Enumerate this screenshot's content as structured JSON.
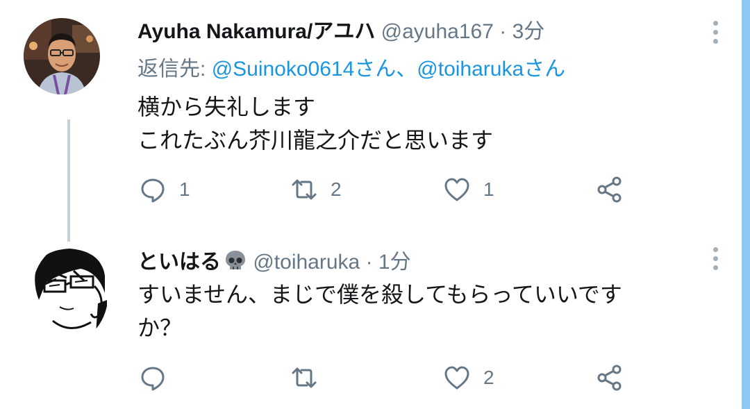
{
  "tweets": [
    {
      "display_name": "Ayuha Nakamura/アユハ",
      "handle": "@ayuha167",
      "separator": "·",
      "time": "3分",
      "reply_prefix": "返信先:",
      "reply_mentions": "@Suinoko0614さん、@toiharukaさん",
      "lines": [
        "横から失礼します",
        "これたぶん芥川龍之介だと思います"
      ],
      "counts": {
        "reply": "1",
        "retweet": "2",
        "like": "1"
      }
    },
    {
      "display_name": "といはる",
      "name_emoji": "skull-icon",
      "handle": "@toiharuka",
      "separator": "·",
      "time": "1分",
      "lines": [
        "すいません、まじで僕を殺してもらっていいです",
        "か？"
      ],
      "counts": {
        "reply": "",
        "retweet": "",
        "like": "2"
      }
    }
  ],
  "colors": {
    "link": "#1b95e0",
    "meta": "#657786",
    "thread_line": "#c4cfd6",
    "scrollbar": "#8fc6f2"
  }
}
